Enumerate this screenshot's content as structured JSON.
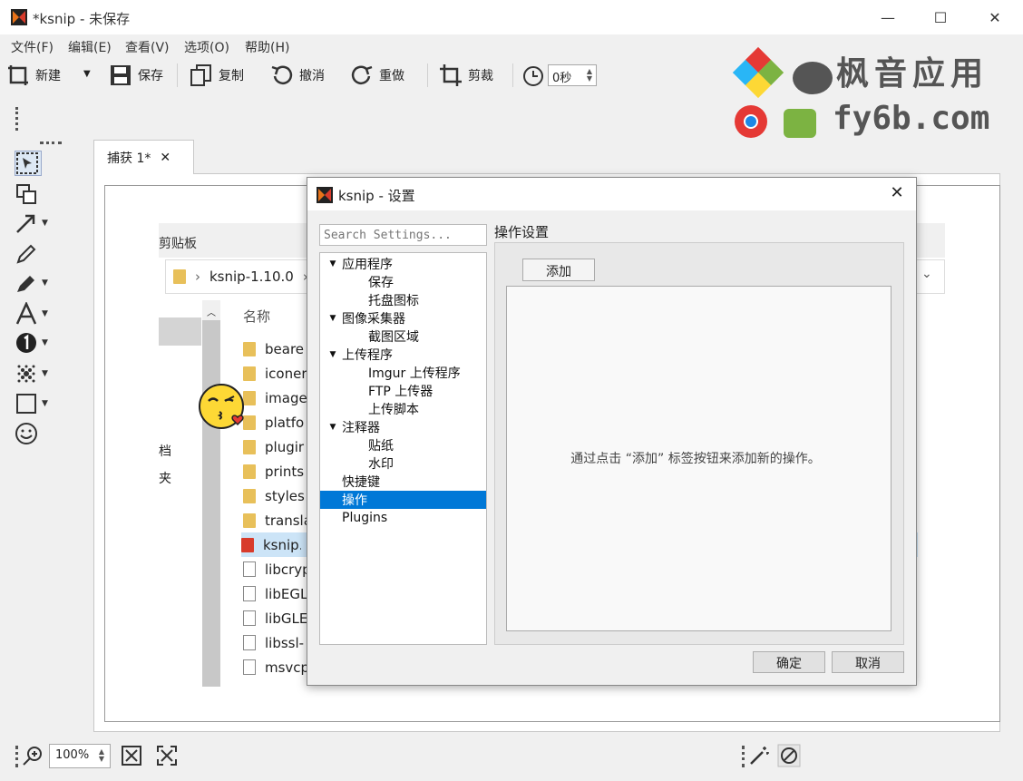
{
  "window": {
    "title": "*ksnip - 未保存",
    "minimize": "—",
    "maximize": "☐",
    "close": "✕"
  },
  "menu": [
    "文件(F)",
    "编辑(E)",
    "查看(V)",
    "选项(O)",
    "帮助(H)"
  ],
  "toolbar": {
    "new": "新建",
    "save": "保存",
    "copy": "复制",
    "undo": "撤消",
    "redo": "重做",
    "crop": "剪裁",
    "delay": "0秒"
  },
  "watermark": {
    "line1": "枫音应用",
    "line2": "fy6b.com"
  },
  "tab": {
    "label": "捕获 1*",
    "close": "✕"
  },
  "captured_explorer": {
    "clipboard": "剪贴板",
    "path": "ksnip-1.10.0",
    "column_name": "名称",
    "side_labels": [
      "档",
      "夹"
    ],
    "files": [
      {
        "name": "beare",
        "type": "folder"
      },
      {
        "name": "iconer",
        "type": "folder"
      },
      {
        "name": "image",
        "type": "folder"
      },
      {
        "name": "platfo",
        "type": "folder"
      },
      {
        "name": "plugir",
        "type": "folder"
      },
      {
        "name": "prints",
        "type": "folder"
      },
      {
        "name": "styles",
        "type": "folder"
      },
      {
        "name": "transla",
        "type": "folder"
      },
      {
        "name": "ksnip.",
        "type": "app"
      },
      {
        "name": "libcryp",
        "type": "file"
      },
      {
        "name": "libEGL",
        "type": "file"
      },
      {
        "name": "libGLE",
        "type": "file"
      },
      {
        "name": "libssl-",
        "type": "file"
      },
      {
        "name": "msvcp",
        "type": "file"
      }
    ]
  },
  "dialog": {
    "title": "ksnip - 设置",
    "close": "✕",
    "search_placeholder": "Search Settings...",
    "tree": [
      {
        "label": "应用程序",
        "level": 0,
        "expanded": true
      },
      {
        "label": "保存",
        "level": 1
      },
      {
        "label": "托盘图标",
        "level": 1
      },
      {
        "label": "图像采集器",
        "level": 0,
        "expanded": true
      },
      {
        "label": "截图区域",
        "level": 1
      },
      {
        "label": "上传程序",
        "level": 0,
        "expanded": true
      },
      {
        "label": "Imgur 上传程序",
        "level": 1
      },
      {
        "label": "FTP 上传器",
        "level": 1
      },
      {
        "label": "上传脚本",
        "level": 1
      },
      {
        "label": "注释器",
        "level": 0,
        "expanded": true
      },
      {
        "label": "贴纸",
        "level": 1
      },
      {
        "label": "水印",
        "level": 1
      },
      {
        "label": "快捷键",
        "level": 0
      },
      {
        "label": "操作",
        "level": 0,
        "selected": true
      },
      {
        "label": "Plugins",
        "level": 0
      }
    ],
    "section_title": "操作设置",
    "add_tab": "添加",
    "hint": "通过点击 “添加” 标签按钮来添加新的操作。",
    "ok": "确定",
    "cancel": "取消"
  },
  "statusbar": {
    "zoom": "100%"
  },
  "colors": {
    "accent": "#0078d7",
    "folder": "#e8c05a"
  }
}
